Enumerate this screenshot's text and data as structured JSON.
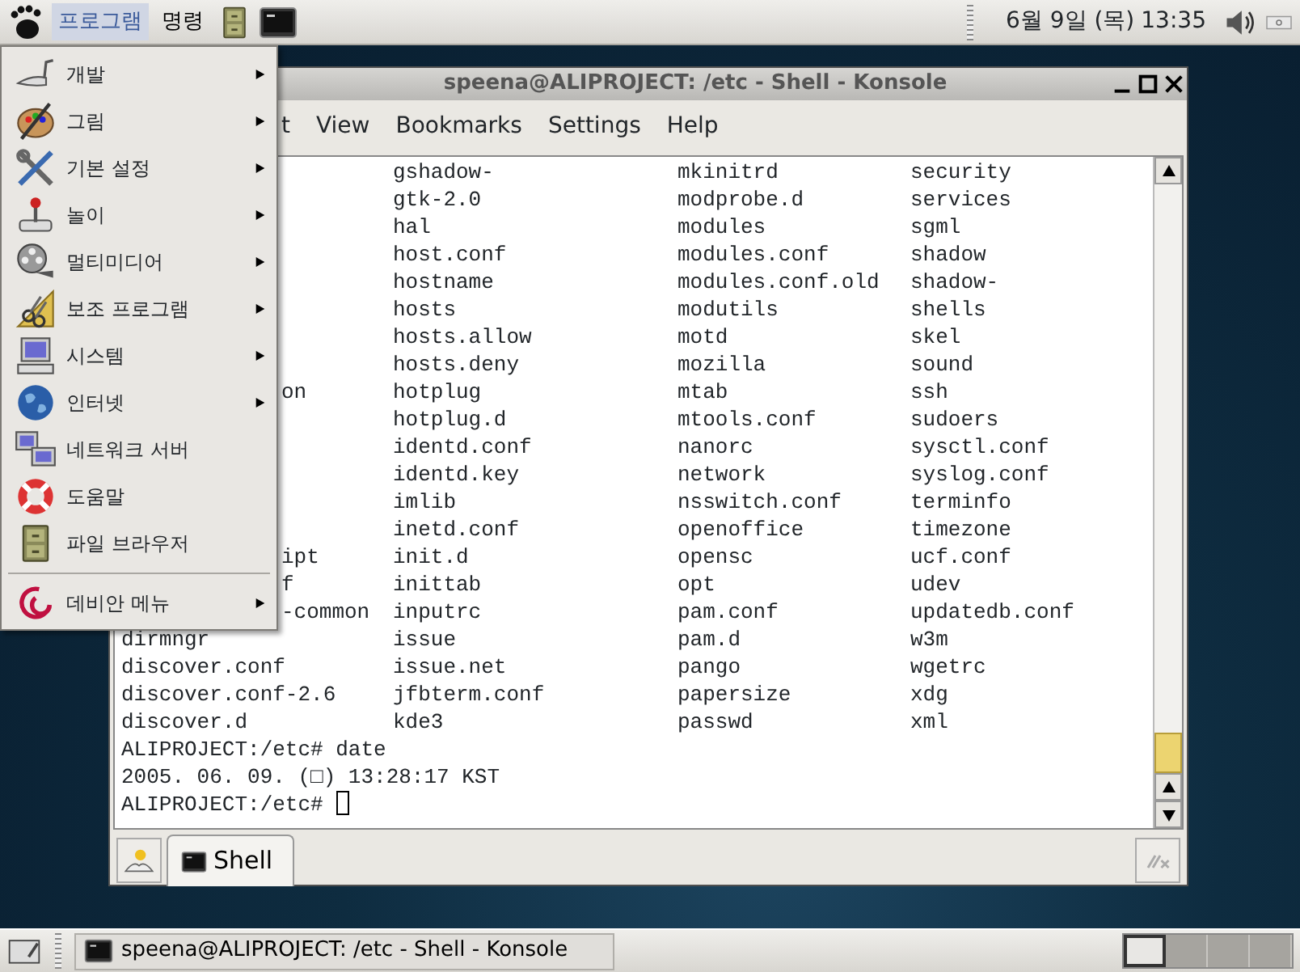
{
  "top_panel": {
    "menus": [
      {
        "label": "프로그램",
        "selected": true
      },
      {
        "label": "명령",
        "selected": false
      }
    ],
    "clock": {
      "date": "6월 9일 (목)",
      "time": "13:35"
    }
  },
  "app_menu": {
    "items": [
      {
        "label": "개발",
        "submenu": true
      },
      {
        "label": "그림",
        "submenu": true
      },
      {
        "label": "기본 설정",
        "submenu": true
      },
      {
        "label": "놀이",
        "submenu": true
      },
      {
        "label": "멀티미디어",
        "submenu": true
      },
      {
        "label": "보조 프로그램",
        "submenu": true
      },
      {
        "label": "시스템",
        "submenu": true
      },
      {
        "label": "인터넷",
        "submenu": true
      },
      {
        "label": "네트워크 서버",
        "submenu": false
      },
      {
        "label": "도움말",
        "submenu": false
      },
      {
        "label": "파일 브라우저",
        "submenu": false
      },
      {
        "label": "데비안 메뉴",
        "submenu": true,
        "separated": true
      }
    ]
  },
  "window": {
    "title": "speena@ALIPROJECT: /etc - Shell - Konsole",
    "menubar": [
      "t",
      "View",
      "Bookmarks",
      "Settings",
      "Help"
    ],
    "terminal": {
      "rows": [
        {
          "cells": [
            "gshadow-",
            "mkinitrd",
            "security"
          ]
        },
        {
          "cells": [
            "gtk-2.0",
            "modprobe.d",
            "services"
          ]
        },
        {
          "cells": [
            "hal",
            "modules",
            "sgml"
          ]
        },
        {
          "cells": [
            "host.conf",
            "modules.conf",
            "shadow"
          ]
        },
        {
          "cells": [
            "hostname",
            "modules.conf.old",
            "shadow-"
          ]
        },
        {
          "cells": [
            "hosts",
            "modutils",
            "shells"
          ]
        },
        {
          "cells": [
            "hosts.allow",
            "motd",
            "skel"
          ]
        },
        {
          "cells": [
            "hosts.deny",
            "mozilla",
            "sound"
          ]
        },
        {
          "cells": [
            "on",
            "hotplug",
            "mtab",
            "ssh"
          ],
          "cut_first": true
        },
        {
          "cells": [
            "hotplug.d",
            "mtools.conf",
            "sudoers"
          ]
        },
        {
          "cells": [
            "identd.conf",
            "nanorc",
            "sysctl.conf"
          ]
        },
        {
          "cells": [
            "identd.key",
            "network",
            "syslog.conf"
          ]
        },
        {
          "cells": [
            "imlib",
            "nsswitch.conf",
            "terminfo"
          ]
        },
        {
          "cells": [
            "inetd.conf",
            "openoffice",
            "timezone"
          ]
        },
        {
          "cells": [
            "ipt",
            "init.d",
            "opensc",
            "ucf.conf"
          ],
          "cut_first": true
        },
        {
          "cells": [
            "f",
            "inittab",
            "opt",
            "udev"
          ],
          "cut_first": true
        },
        {
          "cells": [
            "-common",
            "inputrc",
            "pam.conf",
            "updatedb.conf"
          ],
          "cut_first": true
        },
        {
          "cells": [
            "dirmngr",
            "issue",
            "pam.d",
            "w3m"
          ]
        },
        {
          "cells": [
            "discover.conf",
            "issue.net",
            "pango",
            "wgetrc"
          ]
        },
        {
          "cells": [
            "discover.conf-2.6",
            "jfbterm.conf",
            "papersize",
            "xdg"
          ]
        },
        {
          "cells": [
            "discover.d",
            "kde3",
            "passwd",
            "xml"
          ]
        }
      ],
      "lines": [
        "ALIPROJECT:/etc# date",
        "2005. 06. 09. (□) 13:28:17 KST",
        "ALIPROJECT:/etc#"
      ]
    },
    "tabs": [
      {
        "label": "Shell",
        "selected": true
      }
    ]
  },
  "taskbar": {
    "tasks": [
      {
        "label": "speena@ALIPROJECT: /etc - Shell - Konsole"
      }
    ],
    "pager": [
      {
        "selected": true
      },
      {
        "selected": false
      },
      {
        "selected": false
      },
      {
        "selected": false
      }
    ]
  }
}
